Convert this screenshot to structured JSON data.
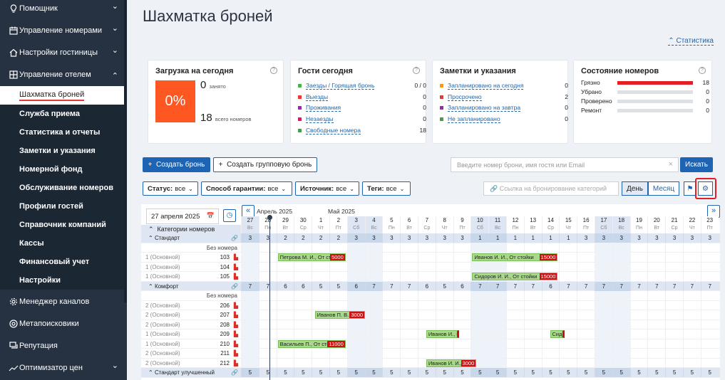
{
  "sidebar": {
    "items_top": [
      {
        "label": "Помощник",
        "icon": "bulb-icon"
      },
      {
        "label": "Управление номерами",
        "icon": "calendar-icon"
      },
      {
        "label": "Настройки гостиницы",
        "icon": "home-icon"
      },
      {
        "label": "Управление отелем",
        "icon": "grid-icon"
      }
    ],
    "sub_items": [
      "Шахматка броней",
      "Служба приема",
      "Статистика и отчеты",
      "Заметки и указания",
      "Номерной фонд",
      "Обслуживание номеров",
      "Профили гостей",
      "Справочник компаний",
      "Кассы",
      "Финансовый учет",
      "Настройки"
    ],
    "items_bottom": [
      {
        "label": "Менеджер каналов",
        "icon": "gear-icon"
      },
      {
        "label": "Метапоисковики",
        "icon": "target-icon"
      },
      {
        "label": "Репутация",
        "icon": "chat-icon"
      },
      {
        "label": "Оптимизатор цен",
        "icon": "chart-icon"
      }
    ]
  },
  "page": {
    "title": "Шахматка броней",
    "stats_link": "Статистика"
  },
  "cards": {
    "load": {
      "title": "Загрузка на сегодня",
      "percent": "0%",
      "occupied": "0",
      "occupied_label": "занято",
      "total": "18",
      "total_label": "всего номеров"
    },
    "guests": {
      "title": "Гости сегодня",
      "rows": [
        {
          "label": "Заезды / Горящая бронь",
          "value": "0 / 0",
          "color": "#4caf50"
        },
        {
          "label": "Выезды",
          "value": "0",
          "color": "#e53935"
        },
        {
          "label": "Проживания",
          "value": "0",
          "color": "#9c27b0"
        },
        {
          "label": "Незаезды",
          "value": "0",
          "color": "#d81b60"
        },
        {
          "label": "Свободные номера",
          "value": "18",
          "color": "#43a047"
        }
      ]
    },
    "notes": {
      "title": "Заметки и указания",
      "rows": [
        {
          "label": "Запланировано на сегодня",
          "value": "0",
          "color": "#ff9800"
        },
        {
          "label": "Просрочено",
          "value": "2",
          "color": "#e53935"
        },
        {
          "label": "Запланировано на завтра",
          "value": "0",
          "color": "#9c27b0"
        },
        {
          "label": "Не запланировано",
          "value": "0",
          "color": "#43a047"
        }
      ]
    },
    "rooms": {
      "title": "Состояние номеров",
      "rows": [
        {
          "label": "Грязно",
          "value": "18",
          "fill": 1
        },
        {
          "label": "Убрано",
          "value": "0",
          "fill": 0
        },
        {
          "label": "Проверено",
          "value": "0",
          "fill": 0
        },
        {
          "label": "Ремонт",
          "value": "0",
          "fill": 0
        }
      ]
    }
  },
  "toolbar": {
    "create": "Создать бронь",
    "create_group": "Создать групповую бронь",
    "search_placeholder": "Введите номер брони, имя гостя или Email",
    "search_btn": "Искать"
  },
  "filters": [
    {
      "label": "Статус:",
      "value": "все"
    },
    {
      "label": "Способ гарантии:",
      "value": "все"
    },
    {
      "label": "Источник:",
      "value": "все"
    },
    {
      "label": "Теги:",
      "value": "все"
    }
  ],
  "booking_link": "Ссылка на бронирование категорий",
  "view": {
    "day": "День",
    "month": "Месяц"
  },
  "calendar": {
    "date": "27 апреля 2025",
    "month_april": "Апрель 2025",
    "month_may": "Май 2025",
    "categories_label": "Категории номеров",
    "days": [
      {
        "d": "27",
        "w": "Вс",
        "we": true
      },
      {
        "d": "28",
        "w": "Пн"
      },
      {
        "d": "29",
        "w": "Вт"
      },
      {
        "d": "30",
        "w": "Ср"
      },
      {
        "d": "1",
        "w": "Чт"
      },
      {
        "d": "2",
        "w": "Пт"
      },
      {
        "d": "3",
        "w": "Сб",
        "we": true
      },
      {
        "d": "4",
        "w": "Вс",
        "we": true
      },
      {
        "d": "5",
        "w": "Пн"
      },
      {
        "d": "6",
        "w": "Вт"
      },
      {
        "d": "7",
        "w": "Ср"
      },
      {
        "d": "8",
        "w": "Чт"
      },
      {
        "d": "9",
        "w": "Пт"
      },
      {
        "d": "10",
        "w": "Сб",
        "we": true
      },
      {
        "d": "11",
        "w": "Вс",
        "we": true
      },
      {
        "d": "12",
        "w": "Пн"
      },
      {
        "d": "13",
        "w": "Вт"
      },
      {
        "d": "14",
        "w": "Ср"
      },
      {
        "d": "15",
        "w": "Чт"
      },
      {
        "d": "16",
        "w": "Пт"
      },
      {
        "d": "17",
        "w": "Сб",
        "we": true
      },
      {
        "d": "18",
        "w": "Вс",
        "we": true
      },
      {
        "d": "19",
        "w": "Пн"
      },
      {
        "d": "20",
        "w": "Вт"
      },
      {
        "d": "21",
        "w": "Ср"
      },
      {
        "d": "22",
        "w": "Чт"
      },
      {
        "d": "23",
        "w": "Пт"
      }
    ],
    "rows": [
      {
        "type": "cat",
        "label": "Стандарт",
        "counts": [
          "3",
          "3",
          "2",
          "2",
          "2",
          "2",
          "3",
          "3",
          "3",
          "3",
          "3",
          "3",
          "3",
          "1",
          "1",
          "1",
          "1",
          "1",
          "1",
          "3",
          "3",
          "3",
          "3",
          "3",
          "3",
          "3",
          "3"
        ]
      },
      {
        "type": "nr",
        "label": "Без номера"
      },
      {
        "type": "room",
        "cap": "1 (Основной)",
        "num": "103"
      },
      {
        "type": "room",
        "cap": "1 (Основной)",
        "num": "104"
      },
      {
        "type": "room",
        "cap": "1 (Основной)",
        "num": "105"
      },
      {
        "type": "cat",
        "label": "Комфорт",
        "counts": [
          "7",
          "7",
          "6",
          "6",
          "5",
          "5",
          "6",
          "7",
          "7",
          "7",
          "6",
          "5",
          "6",
          "7",
          "7",
          "7",
          "7",
          "6",
          "7",
          "7",
          "7",
          "7",
          "7",
          "7",
          "7",
          "7",
          "7"
        ]
      },
      {
        "type": "nr",
        "label": "Без номера"
      },
      {
        "type": "room",
        "cap": "2 (Основной)",
        "num": "206"
      },
      {
        "type": "room",
        "cap": "2 (Основной)",
        "num": "207"
      },
      {
        "type": "room",
        "cap": "2 (Основной)",
        "num": "208"
      },
      {
        "type": "room",
        "cap": "1 (Основной)",
        "num": "209"
      },
      {
        "type": "room",
        "cap": "1 (Основной)",
        "num": "210"
      },
      {
        "type": "room",
        "cap": "2 (Основной)",
        "num": "211"
      },
      {
        "type": "room",
        "cap": "2 (Основной)",
        "num": "212"
      },
      {
        "type": "cat",
        "label": "Стандарт улучшенный",
        "counts": [
          "5",
          "5",
          "5",
          "5",
          "5",
          "5",
          "5",
          "5",
          "5",
          "5",
          "5",
          "5",
          "5",
          "5",
          "5",
          "5",
          "5",
          "5",
          "5",
          "5",
          "5",
          "5",
          "5",
          "5",
          "5",
          "5",
          "5"
        ]
      }
    ],
    "bookings": [
      {
        "row": 2,
        "start": 2,
        "span": 4,
        "text": "Петрова М. И., От сто",
        "price": "5000"
      },
      {
        "row": 2,
        "start": 13,
        "span": 5,
        "text": "Иванов И. И., От стойки",
        "price": "15000"
      },
      {
        "row": 4,
        "start": 13,
        "span": 5,
        "text": "Сидоров И. И., От стойки",
        "price": "15000"
      },
      {
        "row": 8,
        "start": 4.1,
        "span": 3,
        "text": "Иванов П. В.",
        "price": "3000"
      },
      {
        "row": 10,
        "start": 10.4,
        "span": 2,
        "text": "Иванов И., О",
        "price": ""
      },
      {
        "row": 10,
        "start": 17.4,
        "span": 1,
        "text": "Сидо",
        "price": ""
      },
      {
        "row": 11,
        "start": 2,
        "span": 4,
        "text": "Васильев П., От сто",
        "price": "11000"
      },
      {
        "row": 13,
        "start": 10.4,
        "span": 3,
        "text": "Иванов И. И.,",
        "price": "3000"
      }
    ]
  }
}
